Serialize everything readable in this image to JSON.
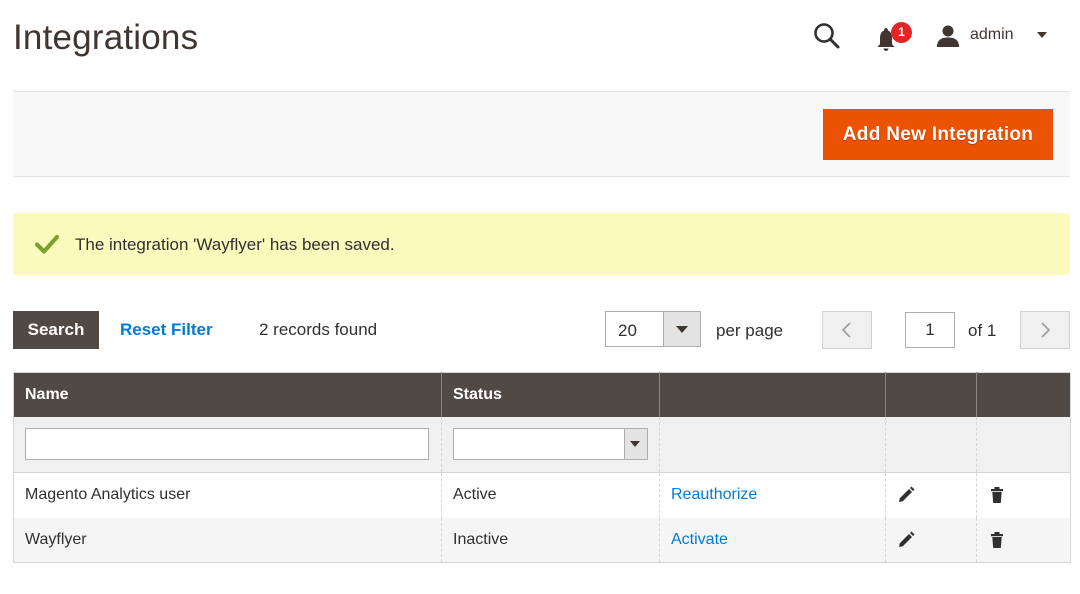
{
  "header": {
    "title": "Integrations",
    "notifications_count": "1",
    "user_name": "admin"
  },
  "actions": {
    "add_label": "Add New Integration"
  },
  "message": {
    "text": "The integration 'Wayflyer' has been saved."
  },
  "toolbar": {
    "search_label": "Search",
    "reset_label": "Reset Filter",
    "records_text": "2 records found",
    "per_page_value": "20",
    "per_page_label": "per page",
    "current_page": "1",
    "of_pages": "of 1"
  },
  "grid": {
    "columns": [
      "Name",
      "Status",
      "",
      "",
      ""
    ],
    "rows": [
      {
        "name": "Magento Analytics user",
        "status": "Active",
        "action": "Reauthorize"
      },
      {
        "name": "Wayflyer",
        "status": "Inactive",
        "action": "Activate"
      }
    ]
  },
  "colors": {
    "accent": "#eb5202",
    "header_bg": "#514943",
    "link": "#007bdb",
    "success_bg": "#fafabc",
    "success_icon": "#79a22e",
    "badge": "#e22626"
  },
  "icons": {
    "search": "search-icon",
    "notifications": "bell-icon",
    "user": "user-icon",
    "success": "checkmark-icon",
    "edit": "pencil-icon",
    "delete": "trash-icon"
  }
}
